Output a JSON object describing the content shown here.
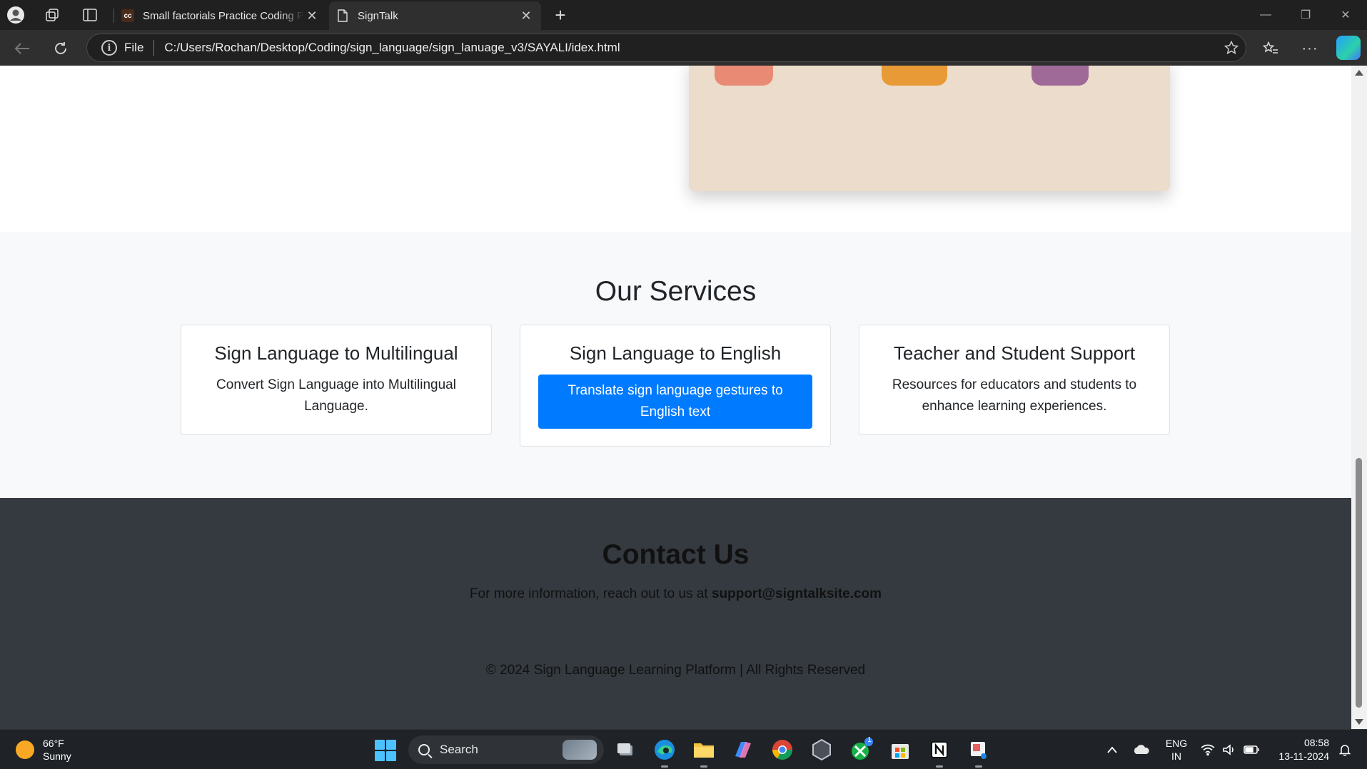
{
  "browser": {
    "tabs": [
      {
        "title": "Small factorials Practice Coding Problem",
        "favicon": "cc",
        "active": false
      },
      {
        "title": "SignTalk",
        "favicon": "page-icon",
        "active": true
      }
    ],
    "address": {
      "protocol_label": "File",
      "url": "C:/Users/Rochan/Desktop/Coding/sign_language/sign_lanuage_v3/SAYALI/idex.html"
    }
  },
  "page": {
    "services": {
      "heading": "Our Services",
      "cards": [
        {
          "title": "Sign Language to Multilingual",
          "text": "Convert Sign Language into Multilingual Language."
        },
        {
          "title": "Sign Language to English",
          "button": "Translate sign language gestures to English text"
        },
        {
          "title": "Teacher and Student Support",
          "text": "Resources for educators and students to enhance learning experiences."
        }
      ]
    },
    "contact": {
      "heading": "Contact Us",
      "text": "For more information, reach out to us at",
      "email": "support@signtalksite.com",
      "copyright": "© 2024 Sign Language Learning Platform | All Rights Reserved"
    }
  },
  "taskbar": {
    "weather": {
      "temp": "66°F",
      "condition": "Sunny"
    },
    "search_placeholder": "Search",
    "language": {
      "line1": "ENG",
      "line2": "IN"
    },
    "time": "08:58",
    "date": "13-11-2024",
    "xbox_badge": "1"
  },
  "colors": {
    "accent_button": "#007bff",
    "footer_bg": "#343a40",
    "services_bg": "#f8f9fa"
  }
}
